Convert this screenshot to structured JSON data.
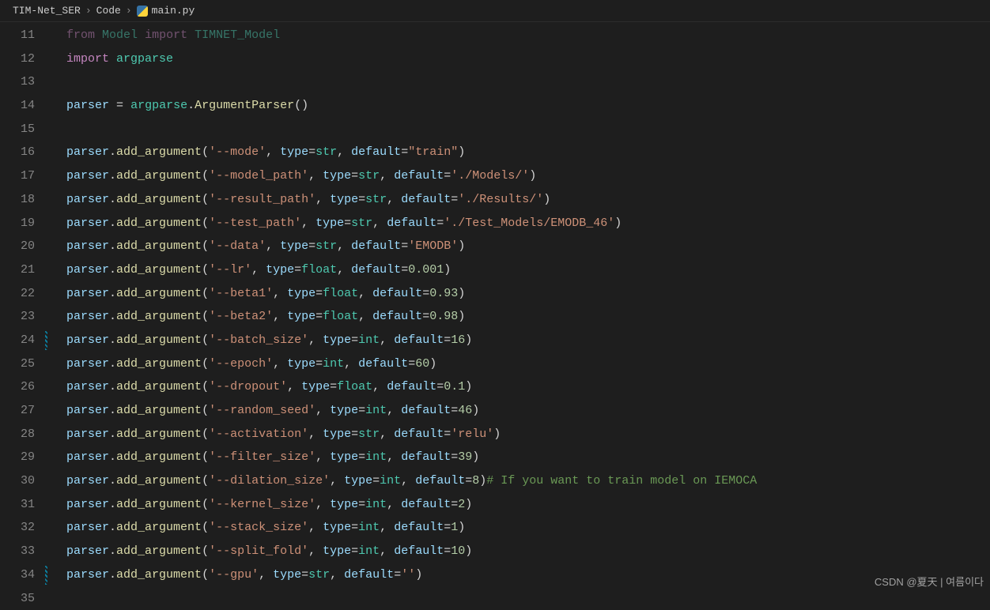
{
  "breadcrumb": {
    "seg0": "TIM-Net_SER",
    "seg1": "Code",
    "file": "main.py",
    "sep": "›"
  },
  "icons": {
    "python": "py-icon"
  },
  "lines": {
    "start": 11,
    "end": 35,
    "modified": [
      24,
      34
    ]
  },
  "code_tokens": {
    "kw_from": "from",
    "kw_import": "import",
    "mod_Model": "Model",
    "mod_TIMNET_Model": "TIMNET_Model",
    "mod_argparse": "argparse",
    "var_parser": "parser",
    "var_type": "type",
    "var_default": "default",
    "cls_ArgumentParser": "ArgumentParser",
    "fn_add_argument": "add_argument",
    "ty_str": "str",
    "ty_float": "float",
    "ty_int": "int"
  },
  "args": {
    "mode": {
      "name": "'--mode'",
      "type": "str",
      "default_s": "\"train\""
    },
    "model_path": {
      "name": "'--model_path'",
      "type": "str",
      "default_s": "'./Models/'"
    },
    "result_path": {
      "name": "'--result_path'",
      "type": "str",
      "default_s": "'./Results/'"
    },
    "test_path": {
      "name": "'--test_path'",
      "type": "str",
      "default_s": "'./Test_Models/EMODB_46'"
    },
    "data": {
      "name": "'--data'",
      "type": "str",
      "default_s": "'EMODB'"
    },
    "lr": {
      "name": "'--lr'",
      "type": "float",
      "default_n": "0.001"
    },
    "beta1": {
      "name": "'--beta1'",
      "type": "float",
      "default_n": "0.93"
    },
    "beta2": {
      "name": "'--beta2'",
      "type": "float",
      "default_n": "0.98"
    },
    "batch_size": {
      "name": "'--batch_size'",
      "type": "int",
      "default_n": "16"
    },
    "epoch": {
      "name": "'--epoch'",
      "type": "int",
      "default_n": "60"
    },
    "dropout": {
      "name": "'--dropout'",
      "type": "float",
      "default_n": "0.1"
    },
    "random_seed": {
      "name": "'--random_seed'",
      "type": "int",
      "default_n": "46"
    },
    "activation": {
      "name": "'--activation'",
      "type": "str",
      "default_s": "'relu'"
    },
    "filter_size": {
      "name": "'--filter_size'",
      "type": "int",
      "default_n": "39"
    },
    "dilation_size": {
      "name": "'--dilation_size'",
      "type": "int",
      "default_n": "8"
    },
    "kernel_size": {
      "name": "'--kernel_size'",
      "type": "int",
      "default_n": "2"
    },
    "stack_size": {
      "name": "'--stack_size'",
      "type": "int",
      "default_n": "1"
    },
    "split_fold": {
      "name": "'--split_fold'",
      "type": "int",
      "default_n": "10"
    },
    "gpu": {
      "name": "'--gpu'",
      "type": "str",
      "default_s": "''"
    }
  },
  "comment": "# If you want to train model on IEMOCA",
  "watermark": "CSDN @夏天 | 여름이다",
  "punct": {
    "eq": "=",
    "dot": ".",
    "lp": "(",
    "rp": ")",
    "comma": ", "
  }
}
